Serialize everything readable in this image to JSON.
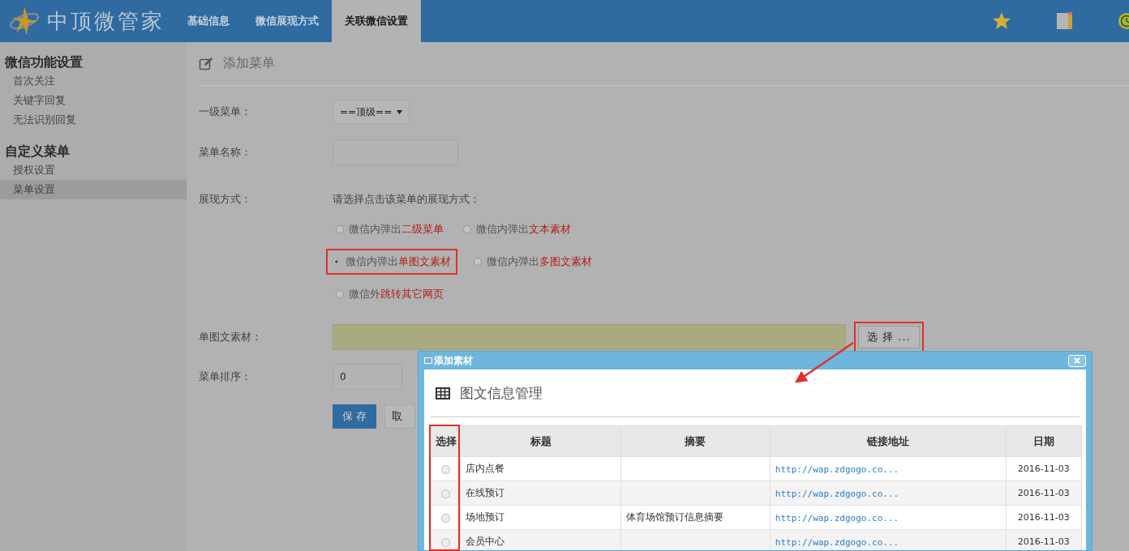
{
  "header": {
    "logo": "中顶微管家",
    "tabs": [
      {
        "label": "基础信息",
        "selected": false
      },
      {
        "label": "微信展现方式",
        "selected": false
      },
      {
        "label": "关联微信设置",
        "selected": true
      }
    ]
  },
  "sidebar": {
    "groups": [
      {
        "title": "微信功能设置",
        "items": [
          {
            "label": "首次关注",
            "selected": false
          },
          {
            "label": "关键字回复",
            "selected": false
          },
          {
            "label": "无法识别回复",
            "selected": false
          }
        ]
      },
      {
        "title": "自定义菜单",
        "items": [
          {
            "label": "授权设置",
            "selected": false
          },
          {
            "label": "菜单设置",
            "selected": true
          }
        ]
      }
    ]
  },
  "form": {
    "title": "添加菜单",
    "parent_menu": {
      "label": "一级菜单：",
      "value": "==顶级=="
    },
    "menu_name": {
      "label": "菜单名称："
    },
    "display": {
      "label": "展现方式：",
      "hint": "请选择点击该菜单的展现方式：",
      "options": [
        {
          "prefix": "微信内弹出",
          "highlight": "二级菜单",
          "selected": false
        },
        {
          "prefix": "微信内弹出",
          "highlight": "文本素材",
          "selected": false
        },
        {
          "prefix": "微信内弹出",
          "highlight": "单图文素材",
          "selected": true
        },
        {
          "prefix": "微信内弹出",
          "highlight": "多图文素材",
          "selected": false
        },
        {
          "prefix": "微信外",
          "highlight": "跳转其它网页",
          "selected": false
        }
      ]
    },
    "material": {
      "label": "单图文素材：",
      "button": "选 择 ..."
    },
    "order": {
      "label": "菜单排序：",
      "value": "0"
    },
    "save": "保 存",
    "cancel": "取"
  },
  "dialog": {
    "title": "添加素材",
    "heading": "图文信息管理",
    "columns": [
      "选择",
      "标题",
      "摘要",
      "链接地址",
      "日期"
    ],
    "rows": [
      {
        "selected": false,
        "title": "店内点餐",
        "summary": "",
        "link": "http://wap.zdgogo.co...",
        "date": "2016-11-03"
      },
      {
        "selected": false,
        "title": "在线预订",
        "summary": "",
        "link": "http://wap.zdgogo.co...",
        "date": "2016-11-03"
      },
      {
        "selected": false,
        "title": "场地预订",
        "summary": "体育场馆预订信息摘要",
        "link": "http://wap.zdgogo.co...",
        "date": "2016-11-03"
      },
      {
        "selected": false,
        "title": "会员中心",
        "summary": "",
        "link": "http://wap.zdgogo.co...",
        "date": "2016-11-03"
      }
    ]
  }
}
